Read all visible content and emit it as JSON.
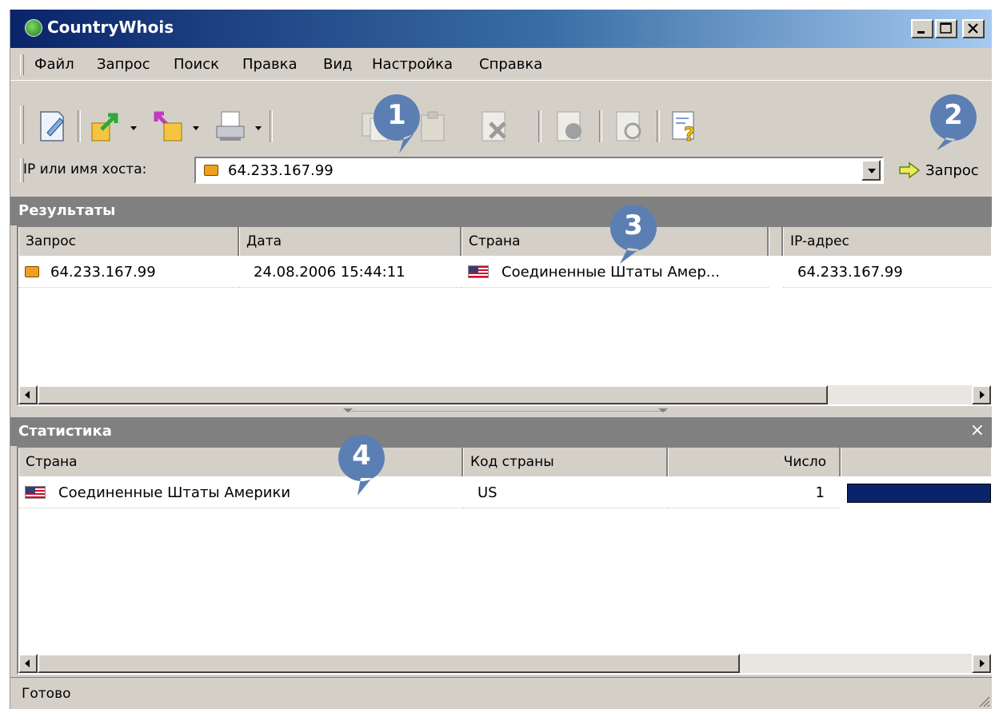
{
  "window": {
    "title": "CountryWhois"
  },
  "menu": [
    "Файл",
    "Запрос",
    "Поиск",
    "Правка",
    "Вид",
    "Настройка",
    "Справка"
  ],
  "toolbar": {
    "icons": [
      "new-query-icon",
      "export-icon",
      "import-icon",
      "print-icon",
      "copy-icon",
      "paste-icon",
      "delete-icon",
      "info-icon",
      "refresh-icon",
      "help-icon"
    ]
  },
  "address": {
    "label": "IP или имя хоста:",
    "value": "64.233.167.99",
    "query_button": "Запрос"
  },
  "results": {
    "title": "Результаты",
    "columns": [
      "Запрос",
      "Дата",
      "Страна",
      "IP-адрес"
    ],
    "rows": [
      {
        "query": "64.233.167.99",
        "date": "24.08.2006 15:44:11",
        "country": "Соединенные Штаты Амер...",
        "ip": "64.233.167.99"
      }
    ]
  },
  "statistics": {
    "title": "Статистика",
    "close": "×",
    "columns": [
      "Страна",
      "Код страны",
      "Число"
    ],
    "rows": [
      {
        "country": "Соединенные Штаты Америки",
        "code": "US",
        "count": "1",
        "bar_fraction": 1.0
      }
    ]
  },
  "status": {
    "text": "Готово"
  },
  "callouts": [
    "1",
    "2",
    "3",
    "4"
  ],
  "colors": {
    "title_start": "#0a246a",
    "title_end": "#a6caf0",
    "panel_header": "#808080",
    "callout": "#5b7fb3",
    "stat_bar": "#0a246a"
  }
}
